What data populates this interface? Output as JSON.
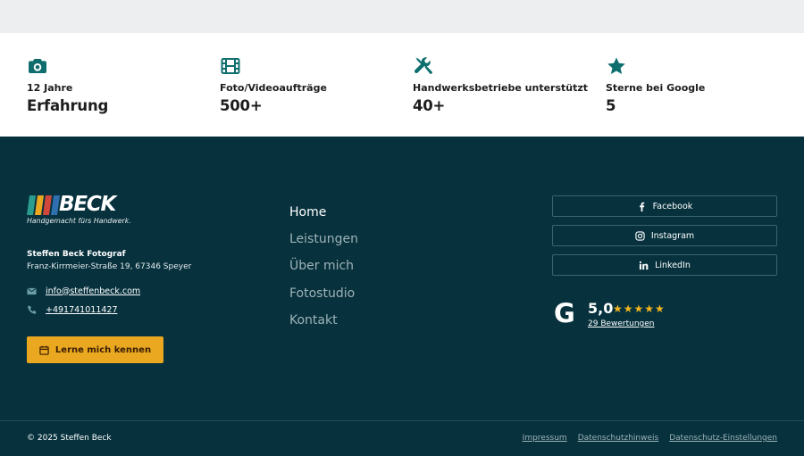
{
  "stats": [
    {
      "icon": "camera-icon",
      "label": "12 Jahre",
      "value": "Erfahrung"
    },
    {
      "icon": "film-icon",
      "label": "Foto/Videoaufträge",
      "value": "500+"
    },
    {
      "icon": "tools-icon",
      "label": "Handwerksbetriebe unterstützt",
      "value": "40+"
    },
    {
      "icon": "star-icon",
      "label": "Sterne bei Google",
      "value": "5"
    }
  ],
  "footer": {
    "logo": {
      "word": "BECK",
      "tagline": "Handgemacht fürs Handwerk.",
      "bar_colors": [
        "#2a9d8f",
        "#e9a81f",
        "#d2473b",
        "#2f6fae"
      ]
    },
    "contact": {
      "name": "Steffen Beck Fotograf",
      "address": "Franz-Kirrmeier-Straße 19, 67346 Speyer",
      "email": "info@steffenbeck.com",
      "phone": "+491741011427"
    },
    "cta_label": "Lerne mich kennen",
    "nav": [
      {
        "label": "Home",
        "active": true
      },
      {
        "label": "Leistungen",
        "active": false
      },
      {
        "label": "Über mich",
        "active": false
      },
      {
        "label": "Fotostudio",
        "active": false
      },
      {
        "label": "Kontakt",
        "active": false
      }
    ],
    "social": [
      {
        "icon": "facebook-icon",
        "label": "Facebook"
      },
      {
        "icon": "instagram-icon",
        "label": "Instagram"
      },
      {
        "icon": "linkedin-icon",
        "label": "LinkedIn"
      }
    ],
    "google": {
      "letter": "G",
      "score": "5,0",
      "stars": "★★★★★",
      "reviews": "29 Bewertungen"
    },
    "copyright": "© 2025 Steffen Beck",
    "legal": [
      "Impressum",
      "Datenschutzhinweis",
      "Datenschutz-Einstellungen"
    ]
  },
  "colors": {
    "footer_bg": "#06313d",
    "accent_teal": "#0e6e6e",
    "cta_bg": "#e9a81f",
    "star": "#f3b61e"
  }
}
